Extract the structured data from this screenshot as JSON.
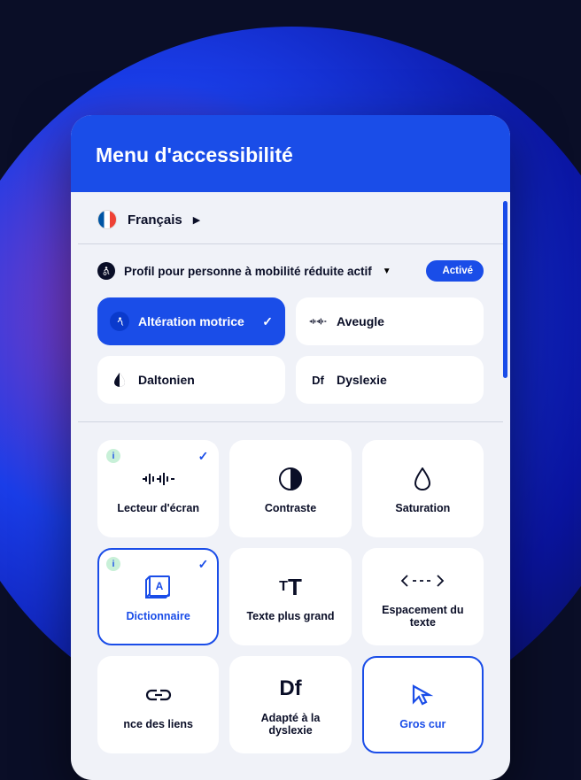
{
  "header": {
    "title": "Menu d'accessibilité"
  },
  "language": {
    "label": "Français"
  },
  "profile": {
    "label": "Profil pour personne à mobilité réduite actif",
    "toggle": "Activé"
  },
  "profiles": {
    "motor": "Altération motrice",
    "blind": "Aveugle",
    "colorblind": "Daltonien",
    "dyslexia": "Dyslexie"
  },
  "cards": {
    "screenReader": "Lecteur d'écran",
    "contrast": "Contraste",
    "saturation": "Saturation",
    "dictionary": "Dictionnaire",
    "biggerText": "Texte plus grand",
    "textSpacing": "Espacement du texte",
    "highlightLinks": "nce des liens",
    "dyslexiaFriendly": "Adapté à la dyslexie",
    "bigCursor": "Gros cur"
  }
}
